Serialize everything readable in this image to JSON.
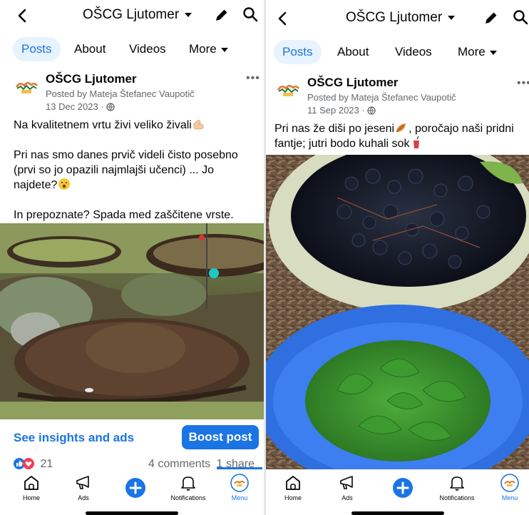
{
  "panels": [
    {
      "header": {
        "title": "OŠCG Ljutomer"
      },
      "tabs": [
        "Posts",
        "About",
        "Videos",
        "More"
      ],
      "post": {
        "author": "OŠCG Ljutomer",
        "posted_by": "Posted by Mateja Štefanec Vaupotič",
        "date": "13 Dec 2023 ·",
        "line1": "Na kvalitetnem vrtu živi veliko živali",
        "line2": "Pri nas smo danes prvič videli čisto posebno (prvi so jo opazili najmlajši učenci) ... Jo najdete?",
        "line3": "In prepoznate? Spada med zaščitene vrste.",
        "insights_label": "See insights and ads",
        "boost_label": "Boost post",
        "reactions_count": "21",
        "comments": "4 comments",
        "shares": "1 share"
      }
    },
    {
      "header": {
        "title": "OŠCG Ljutomer"
      },
      "tabs": [
        "Posts",
        "About",
        "Videos",
        "More"
      ],
      "post": {
        "author": "OŠCG Ljutomer",
        "posted_by": "Posted by Mateja Štefanec Vaupotič",
        "date": "11 Sep 2023 ·",
        "line1a": "Pri nas že diši po jeseni",
        "line1b": ", poročajo naši pridni fantje; jutri bodo kuhali sok"
      }
    }
  ],
  "nav": {
    "home": "Home",
    "ads": "Ads",
    "notifications": "Notifications",
    "menu": "Menu"
  },
  "colors": {
    "accent": "#1b74e4",
    "text": "#050505",
    "secondary": "#65676b"
  }
}
